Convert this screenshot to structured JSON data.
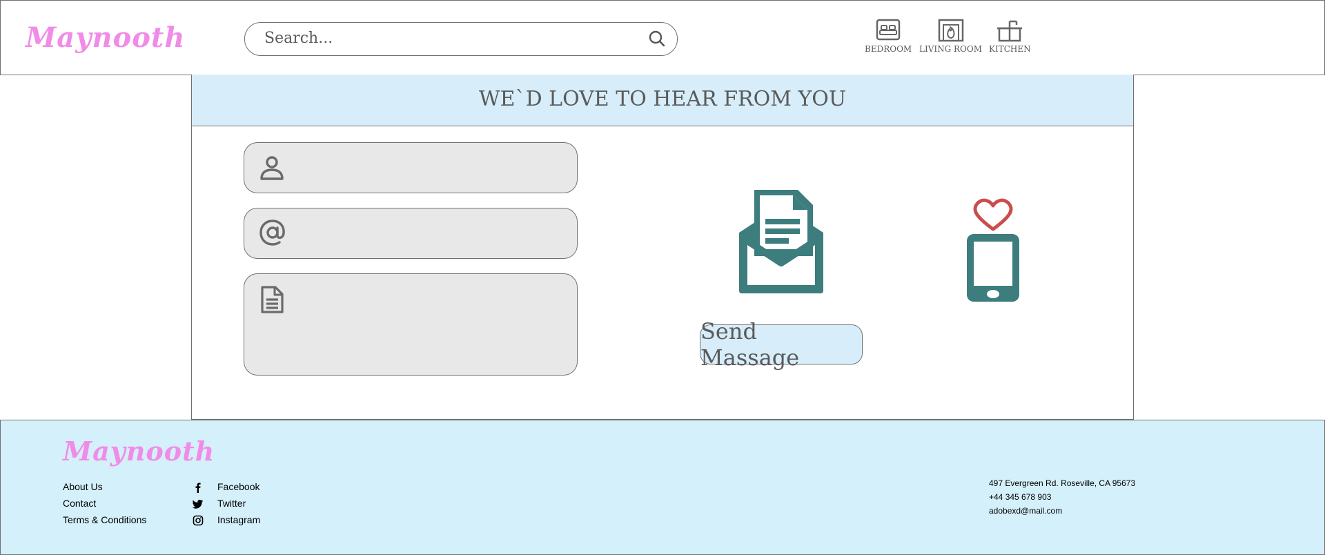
{
  "brand": {
    "logo": "Maynooth",
    "color": "#f08ce8"
  },
  "search": {
    "placeholder": "Search..."
  },
  "nav": {
    "items": [
      {
        "label": "BEDROOM",
        "icon": "bed-icon"
      },
      {
        "label": "LIVING ROOM",
        "icon": "fireplace-icon"
      },
      {
        "label": "KITCHEN",
        "icon": "kitchen-icon"
      }
    ]
  },
  "contact_form": {
    "title": "WE`D LOVE TO HEAR FROM YOU",
    "fields": [
      {
        "icon": "person-icon",
        "value": ""
      },
      {
        "icon": "at-sign-icon",
        "value": ""
      },
      {
        "icon": "document-icon",
        "value": ""
      }
    ],
    "send_label": "Send Massage",
    "illustrations": [
      "envelope-letter-icon",
      "phone-heart-icon"
    ],
    "accent": "#3d7d7d",
    "heart_color": "#cc4d4d",
    "header_bg": "#d7eefa"
  },
  "footer": {
    "logo": "Maynooth",
    "links": [
      "About Us",
      "Contact",
      "Terms & Conditions"
    ],
    "social": [
      {
        "icon": "facebook-icon",
        "label": "Facebook"
      },
      {
        "icon": "twitter-icon",
        "label": "Twitter"
      },
      {
        "icon": "instagram-icon",
        "label": "Instagram"
      }
    ],
    "address": "497 Evergreen Rd. Roseville, CA 95673",
    "phone": "+44 345 678 903",
    "email": "adobexd@mail.com",
    "bg": "#d4f0fa"
  }
}
